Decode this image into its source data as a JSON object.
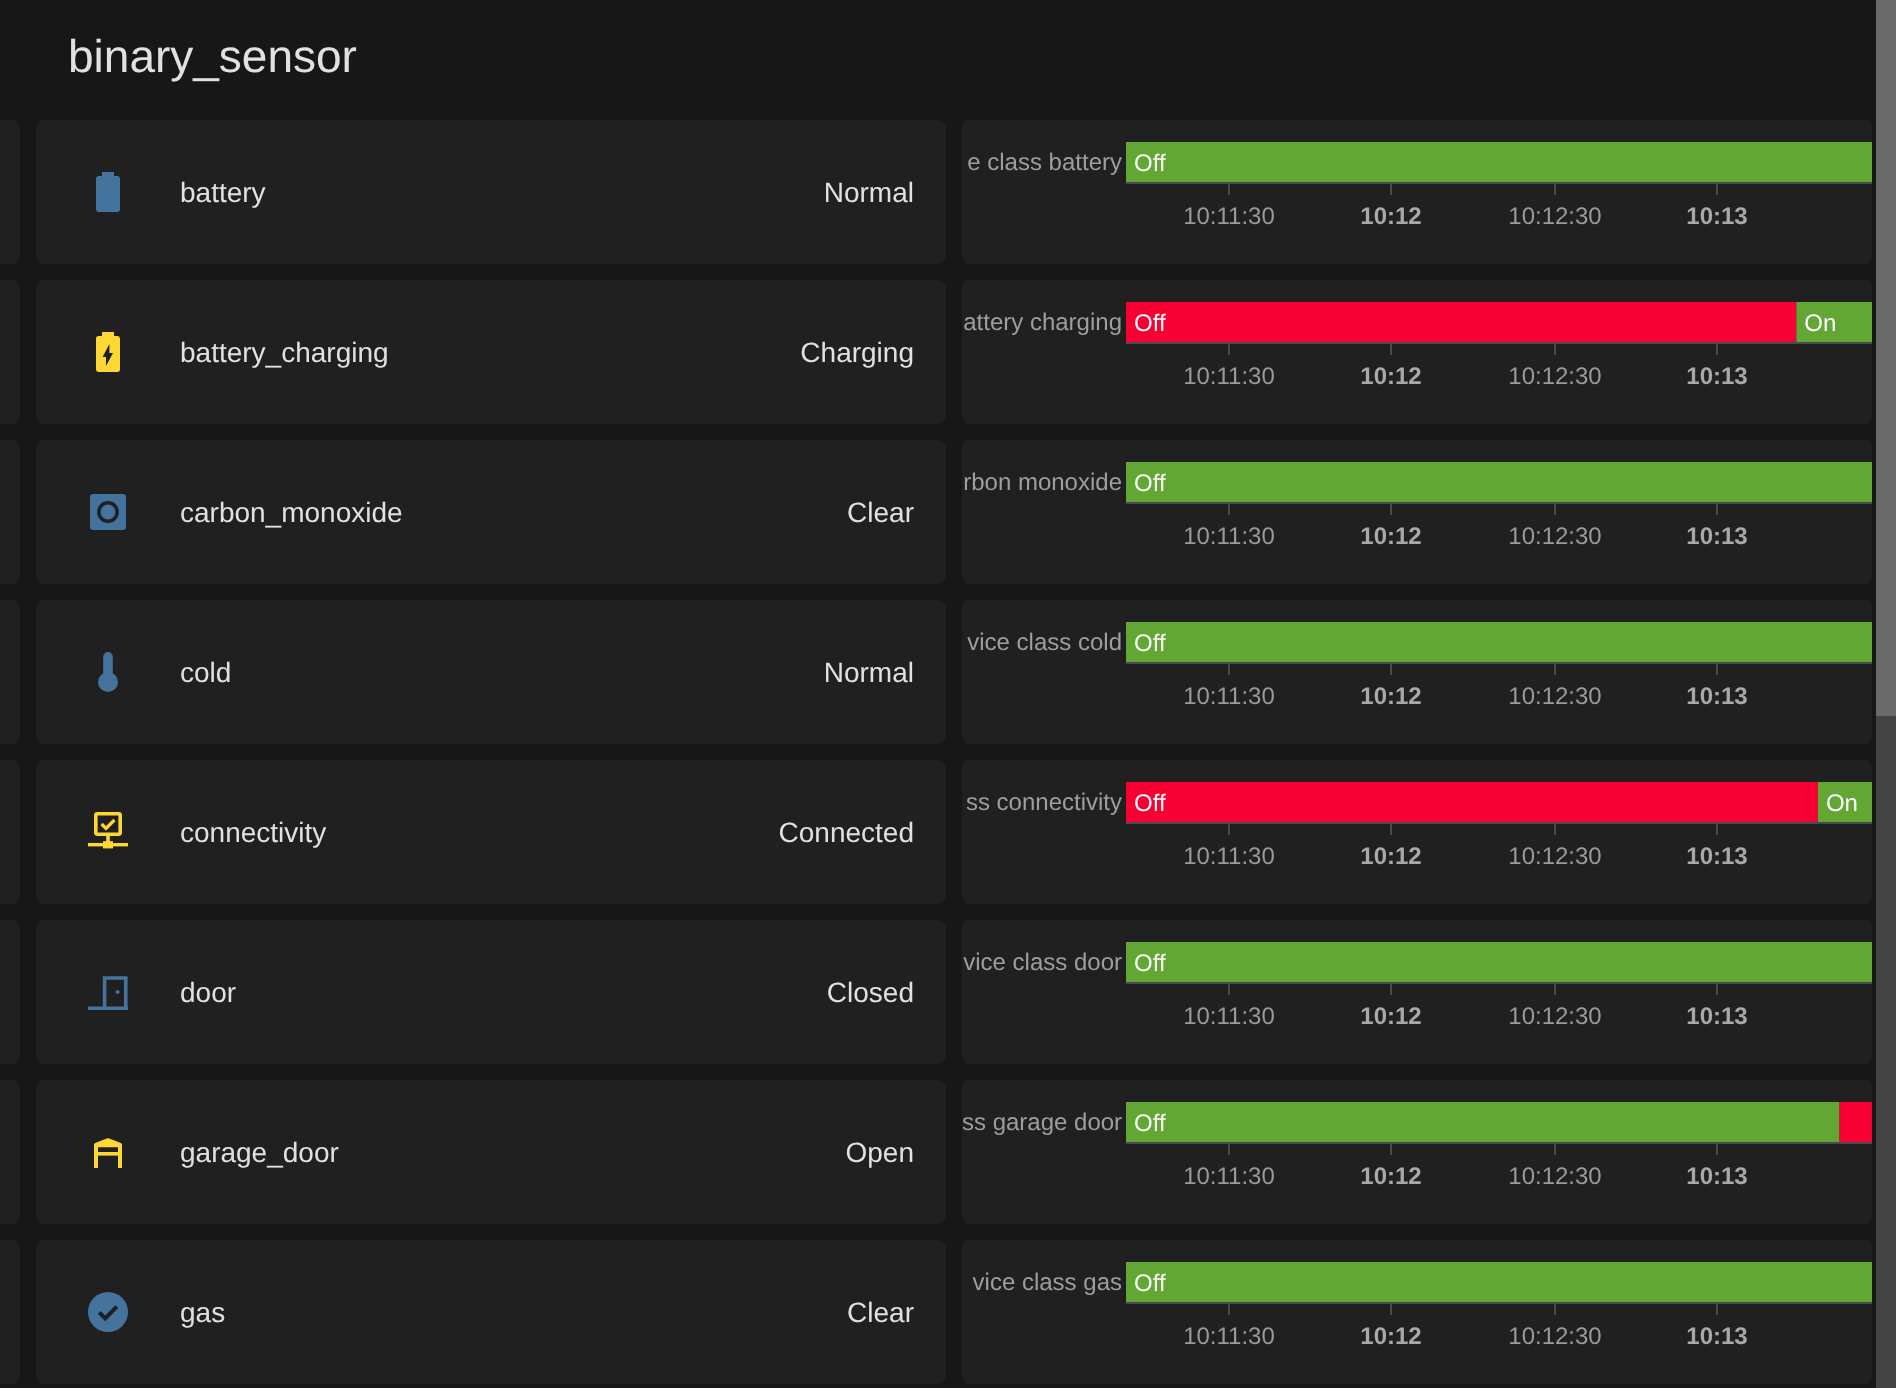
{
  "header": {
    "title": "binary_sensor"
  },
  "rows": [
    {
      "entity": {
        "name": "battery",
        "state": "Normal",
        "on": false,
        "kind": "battery"
      },
      "history": {
        "chart_data": {
          "type": "bar",
          "orientation": "horizontal",
          "categories": [
            "e class battery"
          ],
          "bands": [
            {
              "axis": "x",
              "from": 36671,
              "to": 36809,
              "color": "#62a634",
              "label": "Off"
            }
          ],
          "xlim": [
            36671,
            36809
          ],
          "xticks": [
            {
              "value": 36690,
              "label": "10:11:30"
            },
            {
              "value": 36720,
              "label": "10:12"
            },
            {
              "value": 36750,
              "label": "10:12:30"
            },
            {
              "value": 36780,
              "label": "10:13"
            }
          ]
        }
      }
    },
    {
      "entity": {
        "name": "battery_charging",
        "state": "Charging",
        "on": true,
        "kind": "charging"
      },
      "history": {
        "chart_data": {
          "type": "bar",
          "orientation": "horizontal",
          "categories": [
            "attery charging"
          ],
          "bands": [
            {
              "axis": "x",
              "from": 36671,
              "to": 36795,
              "color": "#f90035",
              "label": "Off"
            },
            {
              "axis": "x",
              "from": 36795,
              "to": 36809,
              "color": "#62a634",
              "label": "On"
            }
          ],
          "xlim": [
            36671,
            36809
          ],
          "xticks": [
            {
              "value": 36690,
              "label": "10:11:30"
            },
            {
              "value": 36720,
              "label": "10:12"
            },
            {
              "value": 36750,
              "label": "10:12:30"
            },
            {
              "value": 36780,
              "label": "10:13"
            }
          ]
        }
      }
    },
    {
      "entity": {
        "name": "carbon_monoxide",
        "state": "Clear",
        "on": false,
        "kind": "smoke"
      },
      "history": {
        "chart_data": {
          "type": "bar",
          "orientation": "horizontal",
          "categories": [
            "rbon monoxide"
          ],
          "bands": [
            {
              "axis": "x",
              "from": 36671,
              "to": 36809,
              "color": "#62a634",
              "label": "Off"
            }
          ],
          "xlim": [
            36671,
            36809
          ],
          "xticks": [
            {
              "value": 36690,
              "label": "10:11:30"
            },
            {
              "value": 36720,
              "label": "10:12"
            },
            {
              "value": 36750,
              "label": "10:12:30"
            },
            {
              "value": 36780,
              "label": "10:13"
            }
          ]
        }
      }
    },
    {
      "entity": {
        "name": "cold",
        "state": "Normal",
        "on": false,
        "kind": "thermometer"
      },
      "history": {
        "chart_data": {
          "type": "bar",
          "orientation": "horizontal",
          "categories": [
            "vice class cold"
          ],
          "bands": [
            {
              "axis": "x",
              "from": 36671,
              "to": 36809,
              "color": "#62a634",
              "label": "Off"
            }
          ],
          "xlim": [
            36671,
            36809
          ],
          "xticks": [
            {
              "value": 36690,
              "label": "10:11:30"
            },
            {
              "value": 36720,
              "label": "10:12"
            },
            {
              "value": 36750,
              "label": "10:12:30"
            },
            {
              "value": 36780,
              "label": "10:13"
            }
          ]
        }
      }
    },
    {
      "entity": {
        "name": "connectivity",
        "state": "Connected",
        "on": true,
        "kind": "network"
      },
      "history": {
        "chart_data": {
          "type": "bar",
          "orientation": "horizontal",
          "categories": [
            "ss connectivity"
          ],
          "bands": [
            {
              "axis": "x",
              "from": 36671,
              "to": 36799,
              "color": "#f90035",
              "label": "Off"
            },
            {
              "axis": "x",
              "from": 36799,
              "to": 36809,
              "color": "#62a634",
              "label": "On"
            }
          ],
          "xlim": [
            36671,
            36809
          ],
          "xticks": [
            {
              "value": 36690,
              "label": "10:11:30"
            },
            {
              "value": 36720,
              "label": "10:12"
            },
            {
              "value": 36750,
              "label": "10:12:30"
            },
            {
              "value": 36780,
              "label": "10:13"
            }
          ]
        }
      }
    },
    {
      "entity": {
        "name": "door",
        "state": "Closed",
        "on": false,
        "kind": "door"
      },
      "history": {
        "chart_data": {
          "type": "bar",
          "orientation": "horizontal",
          "categories": [
            "vice class door"
          ],
          "bands": [
            {
              "axis": "x",
              "from": 36671,
              "to": 36809,
              "color": "#62a634",
              "label": "Off"
            }
          ],
          "xlim": [
            36671,
            36809
          ],
          "xticks": [
            {
              "value": 36690,
              "label": "10:11:30"
            },
            {
              "value": 36720,
              "label": "10:12"
            },
            {
              "value": 36750,
              "label": "10:12:30"
            },
            {
              "value": 36780,
              "label": "10:13"
            }
          ]
        }
      }
    },
    {
      "entity": {
        "name": "garage_door",
        "state": "Open",
        "on": true,
        "kind": "garage"
      },
      "history": {
        "chart_data": {
          "type": "bar",
          "orientation": "horizontal",
          "categories": [
            "ss garage door"
          ],
          "bands": [
            {
              "axis": "x",
              "from": 36671,
              "to": 36803,
              "color": "#62a634",
              "label": "Off"
            },
            {
              "axis": "x",
              "from": 36803,
              "to": 36809,
              "color": "#f90035"
            }
          ],
          "xlim": [
            36671,
            36809
          ],
          "xticks": [
            {
              "value": 36690,
              "label": "10:11:30"
            },
            {
              "value": 36720,
              "label": "10:12"
            },
            {
              "value": 36750,
              "label": "10:12:30"
            },
            {
              "value": 36780,
              "label": "10:13"
            }
          ]
        }
      }
    },
    {
      "entity": {
        "name": "gas",
        "state": "Clear",
        "on": false,
        "kind": "check"
      },
      "history": {
        "chart_data": {
          "type": "bar",
          "orientation": "horizontal",
          "categories": [
            "vice class gas"
          ],
          "bands": [
            {
              "axis": "x",
              "from": 36671,
              "to": 36809,
              "color": "#62a634",
              "label": "Off"
            }
          ],
          "xlim": [
            36671,
            36809
          ],
          "xticks": [
            {
              "value": 36690,
              "label": "10:11:30"
            },
            {
              "value": 36720,
              "label": "10:12"
            },
            {
              "value": 36750,
              "label": "10:12:30"
            },
            {
              "value": 36780,
              "label": "10:13"
            }
          ]
        }
      }
    }
  ]
}
